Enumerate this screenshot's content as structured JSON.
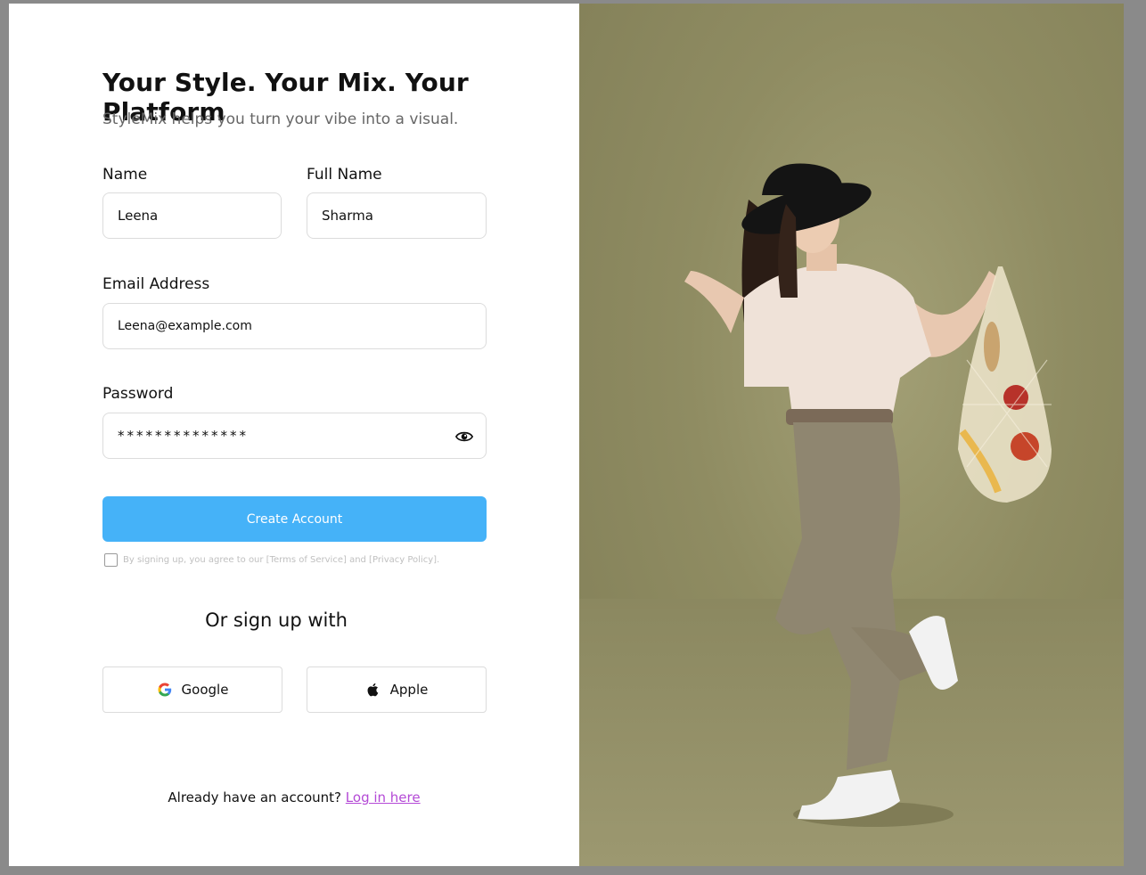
{
  "header": {
    "title": "Your Style. Your Mix. Your Platform",
    "subtitle": "StyleMix helps you turn your vibe into a visual."
  },
  "form": {
    "name_label": "Name",
    "name_value": "Leena",
    "fullname_label": "Full Name",
    "fullname_value": "Sharma",
    "email_label": "Email Address",
    "email_value": "Leena@example.com",
    "password_label": "Password",
    "password_value": "**************",
    "create_button": "Create Account",
    "terms_text": "By signing up, you agree to our [Terms of Service] and [Privacy Policy]."
  },
  "social": {
    "heading": "Or sign up with",
    "google_label": "Google",
    "apple_label": "Apple"
  },
  "footer": {
    "prompt": "Already have an account?",
    "login_link": "Log in here"
  },
  "colors": {
    "primary": "#45b2f8",
    "link": "#b44ad6",
    "photo_background": "#8f8c62"
  },
  "icons": [
    "eye-icon",
    "google-icon",
    "apple-icon"
  ]
}
